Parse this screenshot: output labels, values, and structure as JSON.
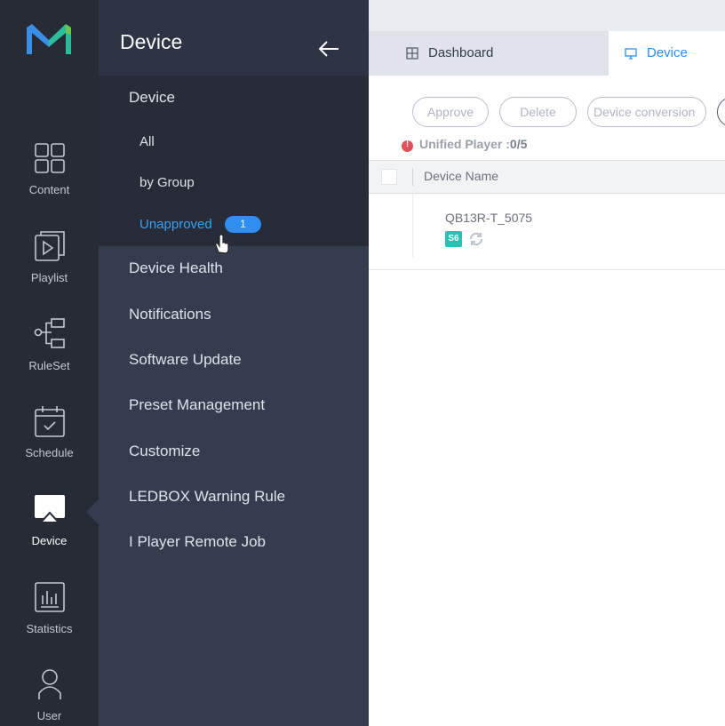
{
  "rail": {
    "items": [
      {
        "label": "Content",
        "icon": "grid-icon"
      },
      {
        "label": "Playlist",
        "icon": "playlist-icon"
      },
      {
        "label": "RuleSet",
        "icon": "ruleset-icon"
      },
      {
        "label": "Schedule",
        "icon": "calendar-icon"
      },
      {
        "label": "Device",
        "icon": "device-icon"
      },
      {
        "label": "Statistics",
        "icon": "chart-icon"
      },
      {
        "label": "User",
        "icon": "user-icon"
      }
    ],
    "active": "Device"
  },
  "subnav": {
    "title": "Device",
    "group": {
      "label": "Device",
      "items": [
        "All",
        "by Group",
        "Unapproved"
      ],
      "badge": "1"
    },
    "items": [
      "Device Health",
      "Notifications",
      "Software Update",
      "Preset Management",
      "Customize",
      "LEDBOX Warning Rule",
      "I Player Remote Job"
    ]
  },
  "tabs": {
    "dashboard": "Dashboard",
    "device": "Device"
  },
  "toolbar": {
    "approve": "Approve",
    "delete": "Delete",
    "conversion": "Device conversion"
  },
  "info": {
    "label": "Unified Player :",
    "count": "0/5"
  },
  "table": {
    "header": "Device Name",
    "rows": [
      {
        "name": "QB13R-T_5075",
        "tag": "S6"
      }
    ]
  },
  "colors": {
    "rail_bg": "#262b35",
    "subnav_bg": "#353c4e",
    "accent": "#2f8ef0",
    "tag": "#2bc0b4",
    "alert": "#e0525b"
  }
}
